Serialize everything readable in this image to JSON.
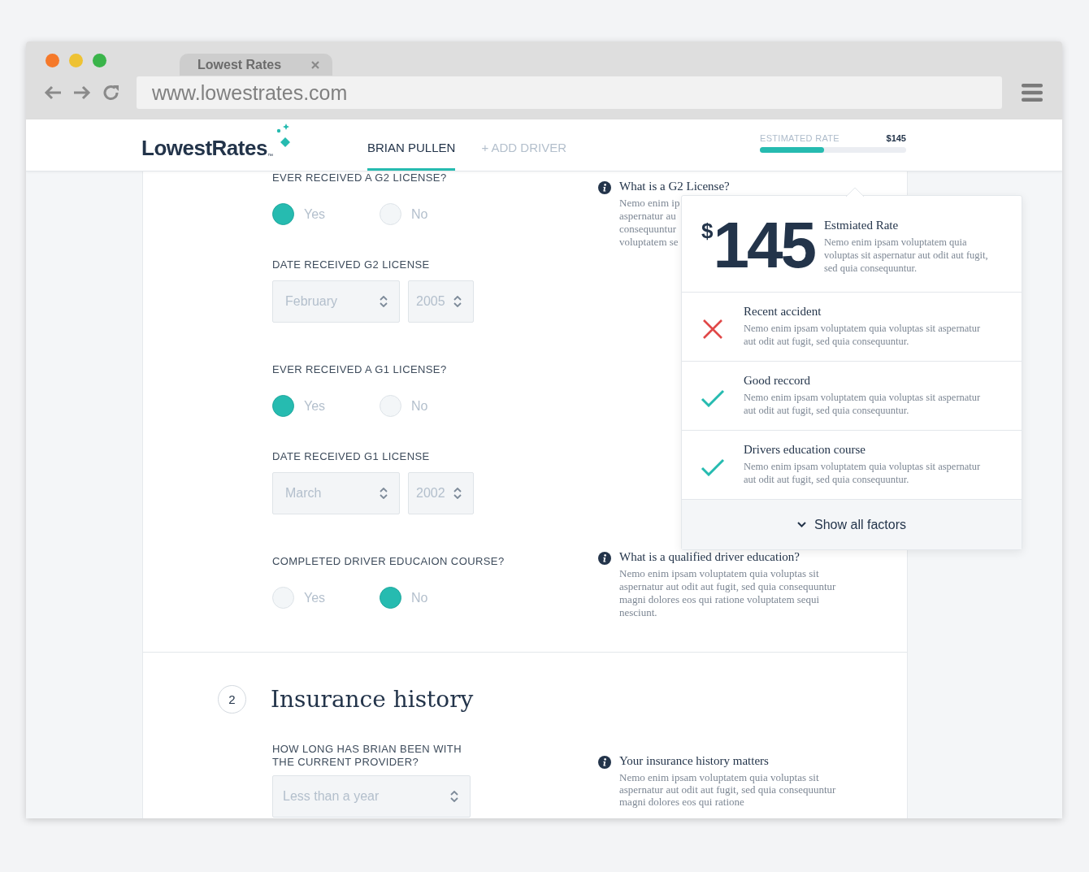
{
  "browser": {
    "tab_title": "Lowest Rates",
    "url": "www.lowestrates.com"
  },
  "header": {
    "logo": "LowestRates",
    "logo_mark": "™",
    "nav": [
      {
        "label": "BRIAN PULLEN",
        "selected": true
      },
      {
        "label": "+ ADD DRIVER",
        "selected": false
      }
    ],
    "estimate": {
      "label": "ESTIMATED RATE",
      "value": "$145",
      "level": 0.44
    }
  },
  "section_1": {
    "questions": [
      {
        "kind": "radio",
        "label": "EVER RECEIVED A G2 LICENSE?",
        "options": [
          {
            "label": "Yes",
            "selected": true
          },
          {
            "label": "No",
            "selected": false
          }
        ],
        "info": {
          "title": "What is a G2 License?",
          "lines": [
            "Nemo enim ip",
            "aspernatur au",
            "consequuntur",
            "voluptatem se"
          ]
        }
      },
      {
        "kind": "date",
        "label": "DATE RECEIVED G2 LICENSE",
        "selects": [
          "February",
          "2005"
        ]
      },
      {
        "kind": "radio",
        "label": "EVER RECEIVED A G1 LICENSE?",
        "options": [
          {
            "label": "Yes",
            "selected": true
          },
          {
            "label": "No",
            "selected": false
          }
        ]
      },
      {
        "kind": "date",
        "label": "DATE RECEIVED G1 LICENSE",
        "selects": [
          "March",
          "2002"
        ]
      },
      {
        "kind": "radio",
        "label": "COMPLETED DRIVER EDUCAION COURSE?",
        "options": [
          {
            "label": "Yes",
            "selected": false
          },
          {
            "label": "No",
            "selected": true
          }
        ],
        "info": {
          "title": "What is a qualified driver education?",
          "text": "Nemo enim ipsam voluptatem quia voluptas sit aspernatur aut odit aut fugit, sed quia consequuntur magni dolores eos qui ratione voluptatem sequi nesciunt."
        }
      }
    ]
  },
  "section_2": {
    "number": "2",
    "title": "Insurance history",
    "question": "HOW LONG HAS BRIAN BEEN WITH THE CURRENT PROVIDER?",
    "select": "Less than a year",
    "info": {
      "title": "Your insurance history matters",
      "text": "Nemo enim ipsam voluptatem quia voluptas sit aspernatur aut odit aut fugit, sed quia consequuntur magni dolores eos qui ratione"
    }
  },
  "popover": {
    "currency": "$",
    "amount": "145",
    "title": "Estmiated Rate",
    "text": "Nemo enim ipsam voluptatem quia voluptas sit aspernatur aut odit aut fugit, sed quia consequuntur.",
    "factors": [
      {
        "kind": "negative",
        "title": "Recent accident",
        "text": "Nemo enim ipsam voluptatem quia voluptas sit aspernatur aut odit aut fugit, sed quia consequuntur."
      },
      {
        "kind": "positive",
        "title": "Good reccord",
        "text": "Nemo enim ipsam voluptatem quia voluptas sit aspernatur aut odit aut fugit, sed quia consequuntur."
      },
      {
        "kind": "positive",
        "title": "Drivers education course",
        "text": "Nemo enim ipsam voluptatem quia voluptas sit aspernatur aut odit aut fugit, sed quia consequuntur."
      }
    ],
    "show_all": "Show all factors"
  }
}
